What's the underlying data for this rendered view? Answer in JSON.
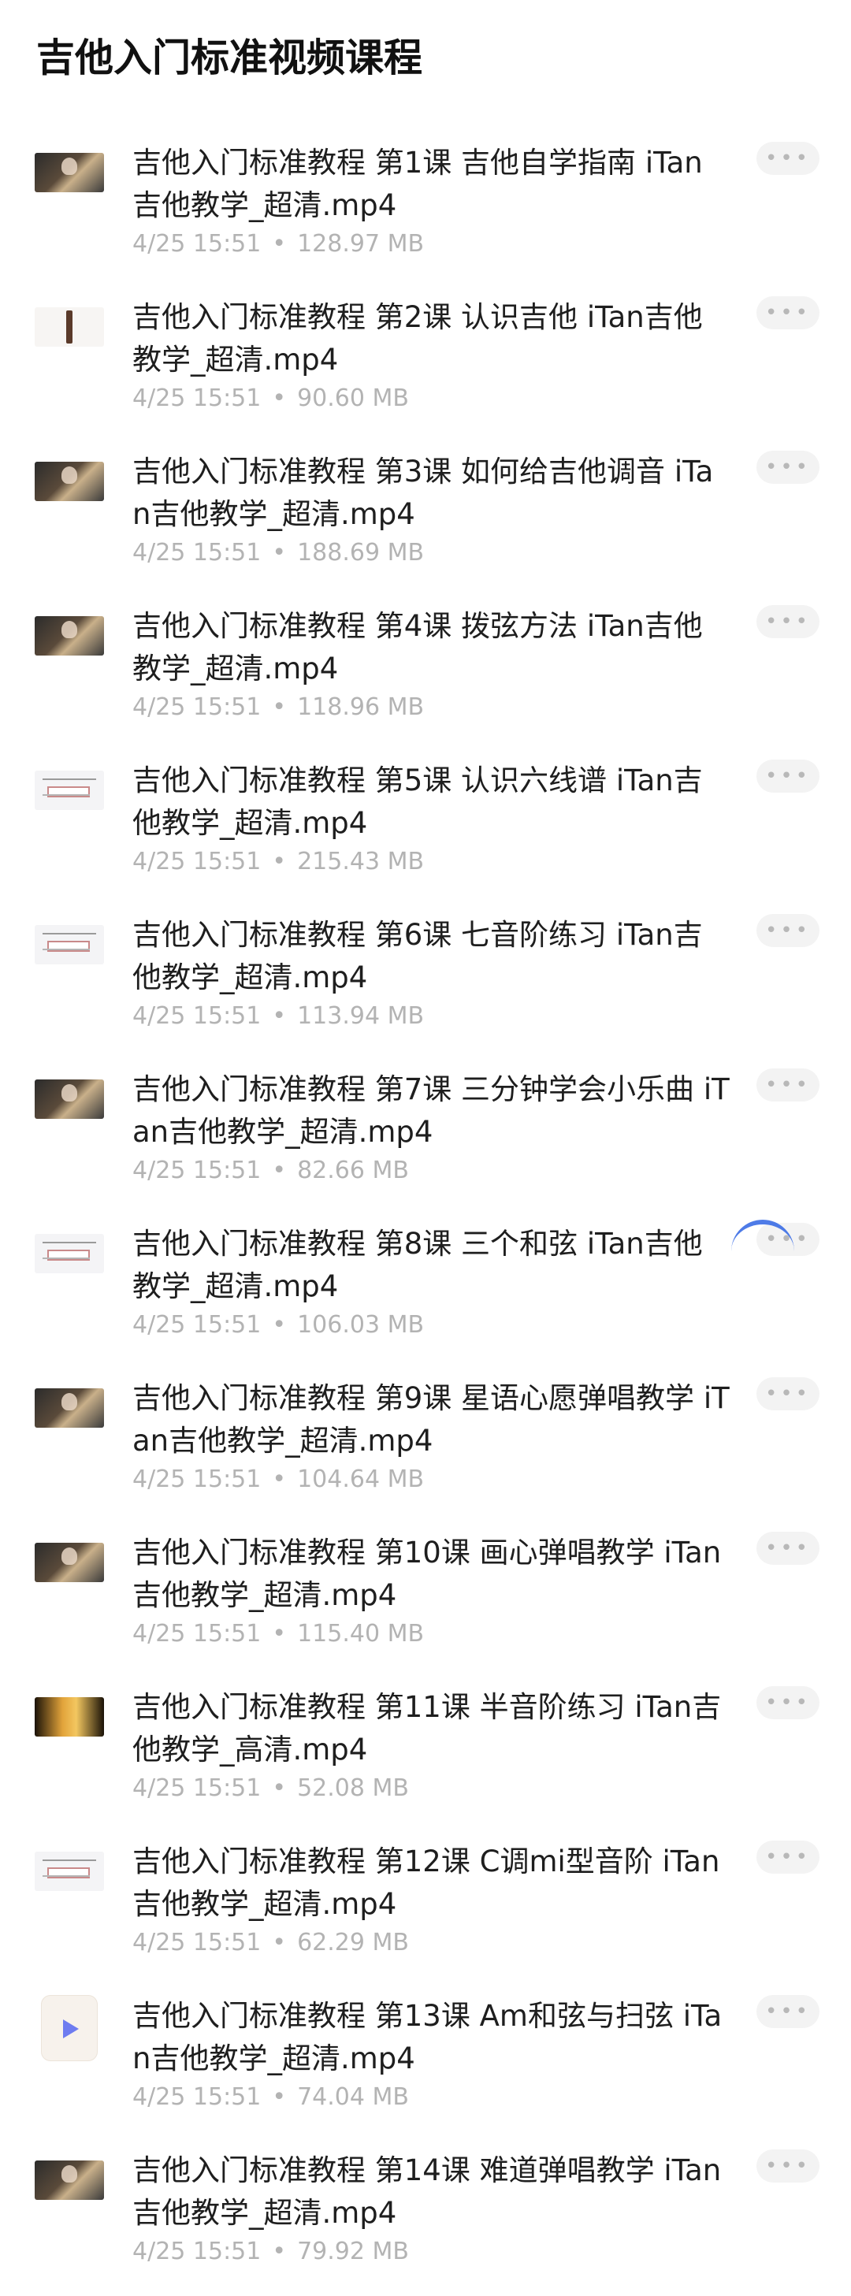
{
  "page": {
    "title": "吉他入门标准视频课程"
  },
  "files": [
    {
      "name": "吉他入门标准教程 第1课 吉他自学指南 iTan吉他教学_超清.mp4",
      "date": "4/25 15:51",
      "size": "128.97 MB",
      "thumb": "dark"
    },
    {
      "name": "吉他入门标准教程 第2课 认识吉他 iTan吉他教学_超清.mp4",
      "date": "4/25 15:51",
      "size": "90.60 MB",
      "thumb": "stick"
    },
    {
      "name": "吉他入门标准教程 第3课 如何给吉他调音 iTan吉他教学_超清.mp4",
      "date": "4/25 15:51",
      "size": "188.69 MB",
      "thumb": "dark"
    },
    {
      "name": "吉他入门标准教程 第4课 拨弦方法 iTan吉他教学_超清.mp4",
      "date": "4/25 15:51",
      "size": "118.96 MB",
      "thumb": "dark"
    },
    {
      "name": "吉他入门标准教程 第5课 认识六线谱 iTan吉他教学_超清.mp4",
      "date": "4/25 15:51",
      "size": "215.43 MB",
      "thumb": "light"
    },
    {
      "name": "吉他入门标准教程 第6课 七音阶练习 iTan吉他教学_超清.mp4",
      "date": "4/25 15:51",
      "size": "113.94 MB",
      "thumb": "light"
    },
    {
      "name": "吉他入门标准教程 第7课 三分钟学会小乐曲 iTan吉他教学_超清.mp4",
      "date": "4/25 15:51",
      "size": "82.66 MB",
      "thumb": "dark"
    },
    {
      "name": "吉他入门标准教程 第8课 三个和弦 iTan吉他教学_超清.mp4",
      "date": "4/25 15:51",
      "size": "106.03 MB",
      "thumb": "light"
    },
    {
      "name": "吉他入门标准教程 第9课 星语心愿弹唱教学 iTan吉他教学_超清.mp4",
      "date": "4/25 15:51",
      "size": "104.64 MB",
      "thumb": "dark"
    },
    {
      "name": "吉他入门标准教程 第10课 画心弹唱教学 iTan吉他教学_超清.mp4",
      "date": "4/25 15:51",
      "size": "115.40 MB",
      "thumb": "dark"
    },
    {
      "name": "吉他入门标准教程 第11课 半音阶练习 iTan吉他教学_高清.mp4",
      "date": "4/25 15:51",
      "size": "52.08 MB",
      "thumb": "sunset"
    },
    {
      "name": "吉他入门标准教程 第12课 C调mi型音阶 iTan吉他教学_超清.mp4",
      "date": "4/25 15:51",
      "size": "62.29 MB",
      "thumb": "light"
    },
    {
      "name": "吉他入门标准教程 第13课 Am和弦与扫弦 iTan吉他教学_超清.mp4",
      "date": "4/25 15:51",
      "size": "74.04 MB",
      "thumb": "play"
    },
    {
      "name": "吉他入门标准教程 第14课 难道弹唱教学 iTan吉他教学_超清.mp4",
      "date": "4/25 15:51",
      "size": "79.92 MB",
      "thumb": "dark"
    }
  ],
  "ui": {
    "more_label": "•••",
    "separator": "•"
  },
  "colors": {
    "accent": "#3b6de5",
    "meta_text": "#b3b3b3"
  }
}
